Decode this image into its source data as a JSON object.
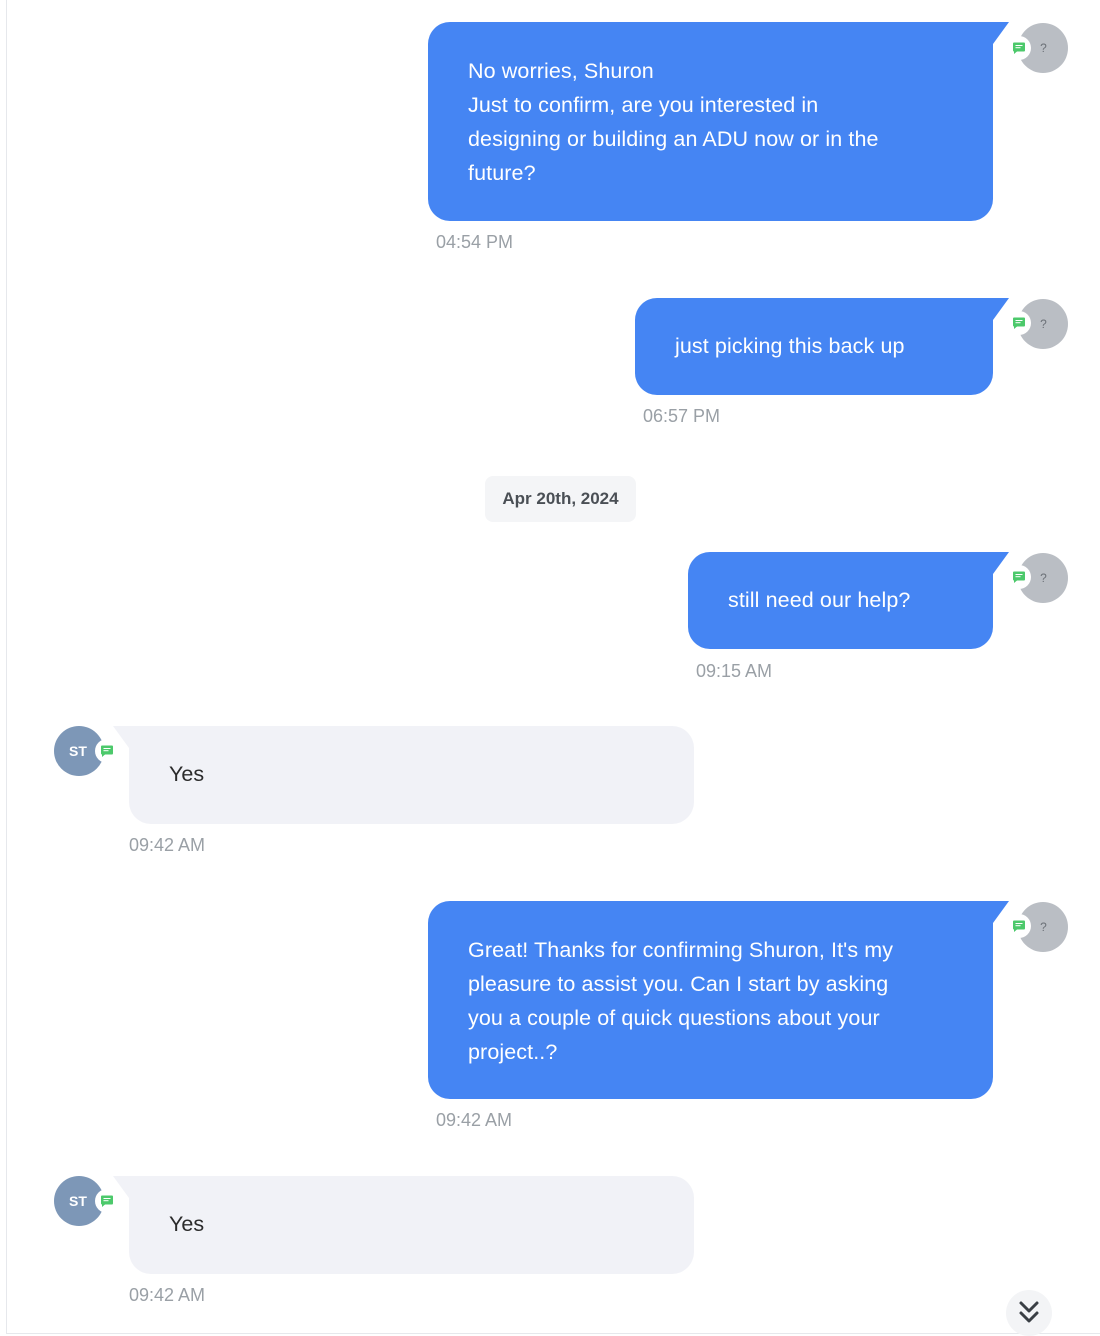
{
  "messages": [
    {
      "direction": "outgoing",
      "text": "No worries, Shuron\nJust to confirm, are you interested in\ndesigning or building an ADU now or in the\nfuture?",
      "time": "04:54 PM",
      "avatar": "?"
    },
    {
      "direction": "outgoing",
      "text": "just picking this back up",
      "time": "06:57 PM",
      "avatar": "?"
    },
    {
      "direction": "outgoing",
      "text": "still need our help?",
      "time": "09:15 AM",
      "avatar": "?"
    },
    {
      "direction": "incoming",
      "text": "Yes",
      "time": "09:42 AM",
      "avatar": "ST"
    },
    {
      "direction": "outgoing",
      "text": "Great! Thanks for confirming Shuron, It's my\npleasure to assist you. Can I start by asking\nyou a couple of quick questions about your\nproject..?",
      "time": "09:42 AM",
      "avatar": "?"
    },
    {
      "direction": "incoming",
      "text": "Yes",
      "time": "09:42 AM",
      "avatar": "ST"
    }
  ],
  "date_separator": "Apr 20th, 2024",
  "icons": {
    "channel": "sms-chat-icon",
    "scroll": "double-chevron-down-icon"
  },
  "colors": {
    "outgoing_bubble": "#4585f3",
    "incoming_bubble": "#f1f2f7",
    "channel_badge": "#4cc96b",
    "contact_avatar": "#7d97b7",
    "agent_avatar": "#babec4"
  }
}
